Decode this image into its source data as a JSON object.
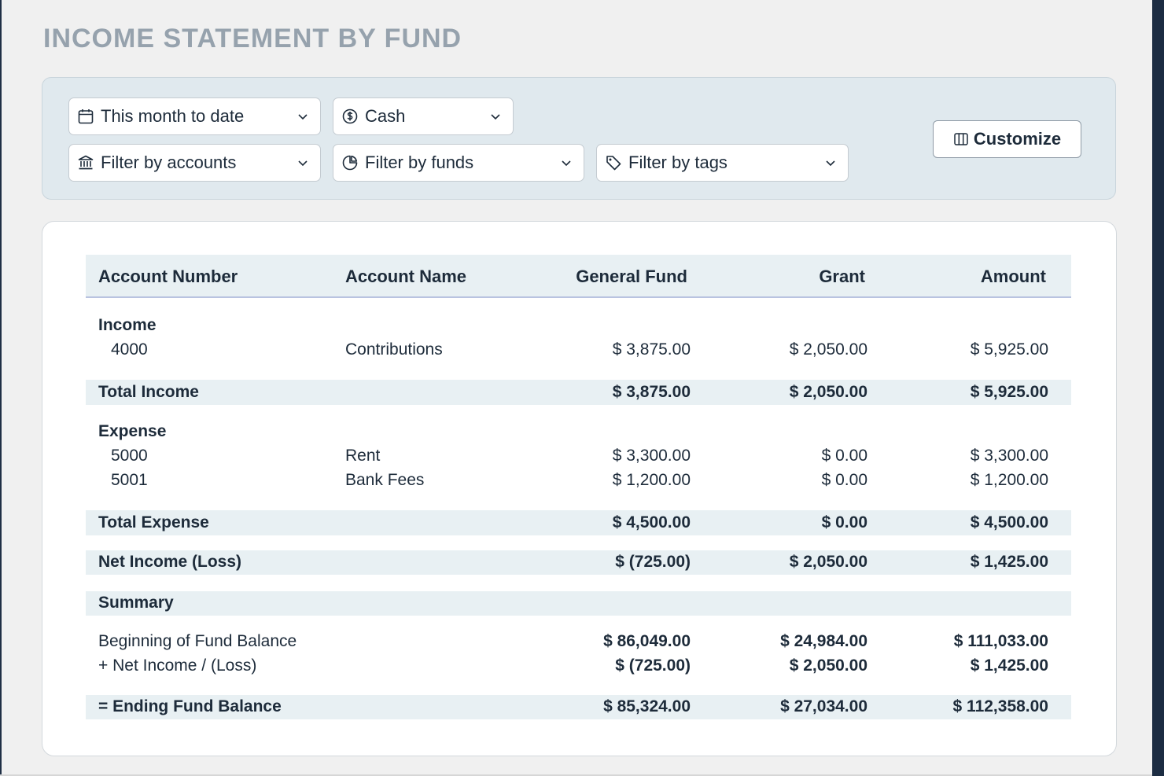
{
  "page": {
    "title": "INCOME STATEMENT BY FUND"
  },
  "filters": {
    "date_range": {
      "label": "This month to date",
      "icon": "calendar-icon"
    },
    "basis": {
      "label": "Cash",
      "icon": "dollar-circle-icon"
    },
    "accounts": {
      "label": "Filter by accounts",
      "icon": "bank-icon"
    },
    "funds": {
      "label": "Filter by funds",
      "icon": "pie-chart-icon"
    },
    "tags": {
      "label": "Filter by tags",
      "icon": "tag-icon"
    },
    "customize": {
      "label": "Customize",
      "icon": "columns-icon"
    }
  },
  "table": {
    "columns": [
      "Account Number",
      "Account Name",
      "General Fund",
      "Grant",
      "Amount"
    ],
    "income": {
      "heading": "Income",
      "rows": [
        {
          "number": "4000",
          "name": "Contributions",
          "general": "$ 3,875.00",
          "grant": "$ 2,050.00",
          "amount": "$ 5,925.00"
        }
      ],
      "total": {
        "label": "Total Income",
        "general": "$ 3,875.00",
        "grant": "$ 2,050.00",
        "amount": "$ 5,925.00"
      }
    },
    "expense": {
      "heading": "Expense",
      "rows": [
        {
          "number": "5000",
          "name": "Rent",
          "general": "$ 3,300.00",
          "grant": "$ 0.00",
          "amount": "$ 3,300.00"
        },
        {
          "number": "5001",
          "name": "Bank Fees",
          "general": "$ 1,200.00",
          "grant": "$ 0.00",
          "amount": "$ 1,200.00"
        }
      ],
      "total": {
        "label": "Total Expense",
        "general": "$ 4,500.00",
        "grant": "$ 0.00",
        "amount": "$ 4,500.00"
      }
    },
    "net_income": {
      "label": "Net Income (Loss)",
      "general": "$ (725.00)",
      "grant": "$ 2,050.00",
      "amount": "$ 1,425.00"
    },
    "summary": {
      "heading": "Summary",
      "beginning": {
        "label": "Beginning of Fund Balance",
        "general": "$ 86,049.00",
        "grant": "$ 24,984.00",
        "amount": "$ 111,033.00"
      },
      "net": {
        "label": "+ Net Income / (Loss)",
        "general": "$ (725.00)",
        "grant": "$ 2,050.00",
        "amount": "$ 1,425.00"
      },
      "ending": {
        "label": "= Ending Fund Balance",
        "general": "$ 85,324.00",
        "grant": "$ 27,034.00",
        "amount": "$ 112,358.00"
      }
    }
  },
  "colors": {
    "title": "#96a2ad",
    "filter_panel": "#e0e9ee",
    "shaded_row": "#e8f0f3",
    "text": "#1d2b3a"
  }
}
